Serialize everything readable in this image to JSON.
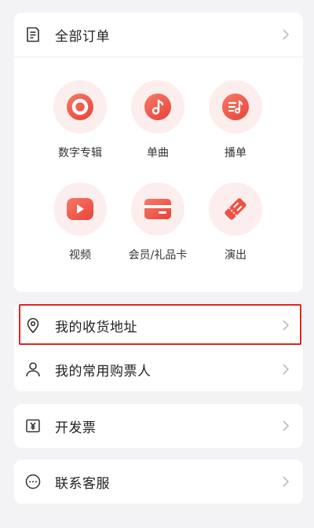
{
  "orders": {
    "all_orders_label": "全部订单",
    "icon": "order-list-icon"
  },
  "categories": [
    {
      "label": "数字专辑",
      "icon": "disc-icon"
    },
    {
      "label": "单曲",
      "icon": "music-note-icon"
    },
    {
      "label": "播单",
      "icon": "playlist-icon"
    },
    {
      "label": "视频",
      "icon": "video-play-icon"
    },
    {
      "label": "会员/礼品卡",
      "icon": "card-icon"
    },
    {
      "label": "演出",
      "icon": "ticket-icon"
    }
  ],
  "account": {
    "address_label": "我的收货地址",
    "address_icon": "location-pin-icon",
    "buyers_label": "我的常用购票人",
    "buyers_icon": "person-icon"
  },
  "invoice": {
    "label": "开发票",
    "icon": "yen-receipt-icon"
  },
  "service": {
    "label": "联系客服",
    "icon": "chat-dots-icon"
  },
  "colors": {
    "accent": "#e8423a",
    "accent_light": "#fdeeee",
    "highlight_border": "#e5231f",
    "background": "#f3f3f5"
  }
}
